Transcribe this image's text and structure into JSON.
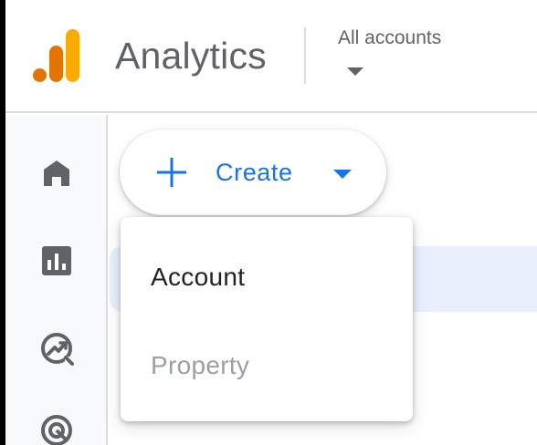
{
  "header": {
    "product_name": "Analytics",
    "account_picker_label": "All accounts"
  },
  "nav_rail": {
    "items": [
      {
        "icon": "home-icon"
      },
      {
        "icon": "reports-icon"
      },
      {
        "icon": "explore-icon"
      },
      {
        "icon": "advertising-icon"
      }
    ]
  },
  "create_button": {
    "label": "Create"
  },
  "create_menu": {
    "items": [
      {
        "label": "Account",
        "enabled": true
      },
      {
        "label": "Property",
        "enabled": false
      }
    ]
  },
  "colors": {
    "accent": "#1a73e8",
    "logo_dark": "#e37400",
    "logo_light": "#f9ab00",
    "icon_gray": "#5f6368",
    "selected_bg": "#e8f0fe",
    "disabled_text": "#9aa0a6"
  }
}
